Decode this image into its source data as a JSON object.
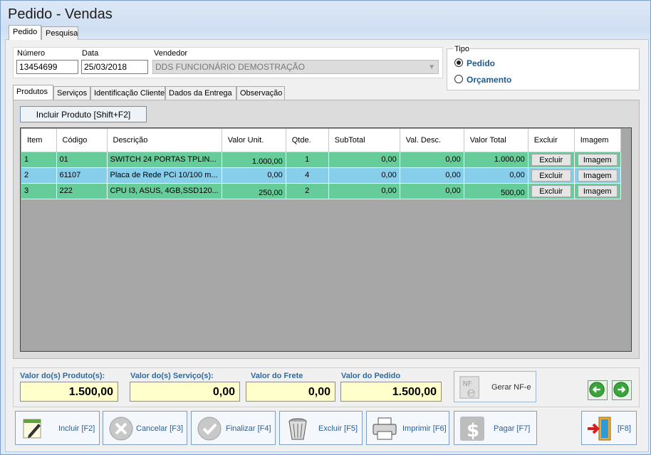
{
  "window": {
    "title": "Pedido - Vendas"
  },
  "top_tabs": [
    {
      "label": "Pedido"
    },
    {
      "label": "Pesquisa"
    }
  ],
  "header": {
    "numero_label": "Número",
    "numero_value": "13454699",
    "data_label": "Data",
    "data_value": "25/03/2018",
    "vendedor_label": "Vendedor",
    "vendedor_value": "DDS FUNCIONÁRIO DEMOSTRAÇÃO"
  },
  "tipo": {
    "title": "Tipo",
    "options": [
      {
        "label": "Pedido",
        "selected": true
      },
      {
        "label": "Orçamento",
        "selected": false
      }
    ]
  },
  "inner_tabs": [
    {
      "label": "Produtos"
    },
    {
      "label": "Serviços"
    },
    {
      "label": "Identificação Cliente"
    },
    {
      "label": "Dados da Entrega"
    },
    {
      "label": "Observação"
    }
  ],
  "incluir_button": "Incluir Produto [Shift+F2]",
  "grid": {
    "columns": [
      "Item",
      "Código",
      "Descrição",
      "Valor Unit.",
      "Qtde.",
      "SubTotal",
      "Val. Desc.",
      "Valor Total",
      "Excluir",
      "Imagem"
    ],
    "rows": [
      {
        "item": "1",
        "codigo": "01",
        "descricao": "SWITCH 24 PORTAS  TPLIN...",
        "valor_unit": "1.000,00",
        "qtde": "1",
        "subtotal": "0,00",
        "val_desc": "0,00",
        "valor_total": "1.000,00",
        "excluir": "Excluir",
        "imagem": "Imagem",
        "color": "#66cc99"
      },
      {
        "item": "2",
        "codigo": "61107",
        "descricao": "Placa de Rede PCi 10/100 m...",
        "valor_unit": "0,00",
        "qtde": "4",
        "subtotal": "0,00",
        "val_desc": "0,00",
        "valor_total": "0,00",
        "excluir": "Excluir",
        "imagem": "Imagem",
        "color": "#87ceeb"
      },
      {
        "item": "3",
        "codigo": "222",
        "descricao": "CPU I3, ASUS, 4GB,SSD120...",
        "valor_unit": "250,00",
        "qtde": "2",
        "subtotal": "0,00",
        "val_desc": "0,00",
        "valor_total": "500,00",
        "excluir": "Excluir",
        "imagem": "Imagem",
        "color": "#66cc99"
      }
    ]
  },
  "totals": {
    "produtos_label": "Valor do(s) Produto(s):",
    "produtos_value": "1.500,00",
    "servicos_label": "Valor do(s) Serviço(s):",
    "servicos_value": "0,00",
    "frete_label": "Valor do Frete",
    "frete_value": "0,00",
    "pedido_label": "Valor do Pedido",
    "pedido_value": "1.500,00",
    "nfe_label": "Gerar NF-e"
  },
  "actions": {
    "incluir": "Incluir [F2]",
    "cancelar": "Cancelar [F3]",
    "finalizar": "Finalizar [F4]",
    "excluir": "Excluir [F5]",
    "imprimir": "Imprimir [F6]",
    "pagar": "Pagar  [F7]",
    "sair": "[F8]"
  },
  "icons": [
    "back-arrow-icon",
    "forward-arrow-icon",
    "edit-note-icon",
    "cancel-icon",
    "check-icon",
    "trash-icon",
    "printer-icon",
    "dollar-icon",
    "exit-door-icon",
    "nfe-icon"
  ]
}
